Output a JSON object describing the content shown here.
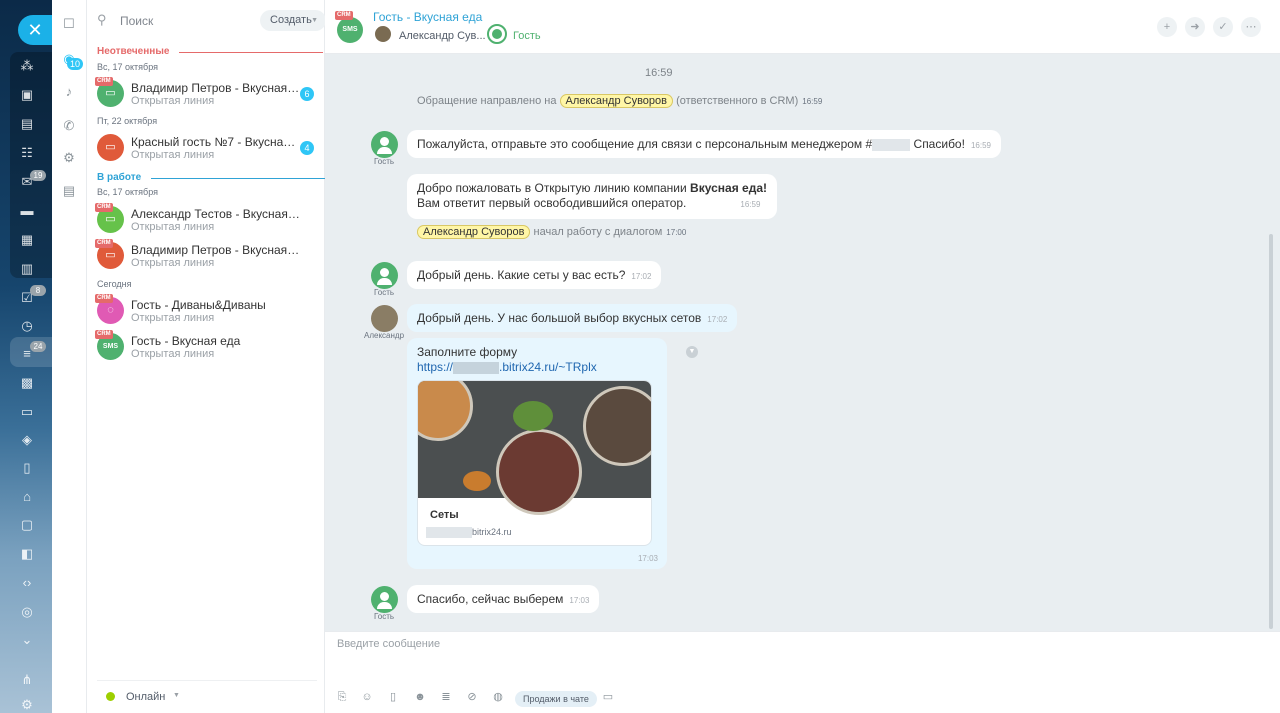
{
  "rail": {
    "badges": {
      "mail": "19",
      "tasks": "8",
      "filter": "24"
    }
  },
  "side": {
    "chats_badge": "10"
  },
  "list": {
    "search_placeholder": "Поиск",
    "create_label": "Создать",
    "sections": [
      {
        "title": "Неотвеченные",
        "color": "#e56a6a"
      },
      {
        "title": "В работе",
        "color": "#2fa3d6"
      }
    ],
    "dates": [
      "Вс, 17 октября",
      "Пт, 22 октября",
      "Вс, 17 октября",
      "Сегодня"
    ],
    "items": [
      {
        "name": "Владимир Петров - Вкусная еда",
        "sub": "Открытая линия",
        "count": "6",
        "color": "#4fb16f",
        "crm": "CRM"
      },
      {
        "name": "Красный гость №7 - Вкусная еда",
        "sub": "Открытая линия",
        "count": "4",
        "color": "#e05a3a",
        "crm": "CRM"
      },
      {
        "name": "Александр Тестов - Вкусная еда",
        "sub": "Открытая линия",
        "color": "#66c24a",
        "crm": "CRM"
      },
      {
        "name": "Владимир Петров - Вкусная еда",
        "sub": "Открытая линия",
        "color": "#e05a3a",
        "crm": "CRM"
      },
      {
        "name": "Гость - Диваны&Диваны",
        "sub": "Открытая линия",
        "color": "#e05ab4",
        "crm": "CRM"
      },
      {
        "name": "Гость - Вкусная еда",
        "sub": "Открытая линия",
        "color": "#4fb16f",
        "crm": "CRM"
      }
    ],
    "status": "Онлайн"
  },
  "header": {
    "title": "Гость - Вкусная еда",
    "crm": "CRM",
    "sms": "SMS",
    "member1": "Александр Сув...",
    "member2": "Гость"
  },
  "messages": {
    "time0": "16:59",
    "sys1_pre": "Обращение направлено на",
    "sys1_tag": "Александр Суворов",
    "sys1_post": "(ответственного в CRM)",
    "sys1_time": "16:59",
    "m1_pre": "Пожалуйста, отправьте это сообщение для связи с персональным менеджером #",
    "m1_post": " Спасибо!",
    "m1_time": "16:59",
    "m2_l1_pre": "Добро пожаловать в Открытую линию компании ",
    "m2_l1_bold": "Вкусная еда!",
    "m2_l2": "Вам ответит первый освободившийся оператор.",
    "m2_time": "16:59",
    "sys2_tag": "Александр Суворов",
    "sys2_post": "начал работу с диалогом",
    "sys2_time": "17:00",
    "m3": "Добрый день. Какие сеты у вас есть?",
    "m3_time": "17:02",
    "m4": "Добрый день. У нас большой выбор вкусных сетов",
    "m4_time": "17:02",
    "card_title": "Заполните форму",
    "card_link_pre": "https://",
    "card_link_post": ".bitrix24.ru/~TRplx",
    "preview_title": "Сеты",
    "preview_url": "bitrix24.ru",
    "card_time": "17:03",
    "m5": "Спасибо, сейчас выберем",
    "m5_time": "17:03",
    "guest_label": "Гость",
    "op_label": "Александр"
  },
  "input": {
    "placeholder": "Введите сообщение",
    "sales_pill": "Продажи в чате"
  }
}
